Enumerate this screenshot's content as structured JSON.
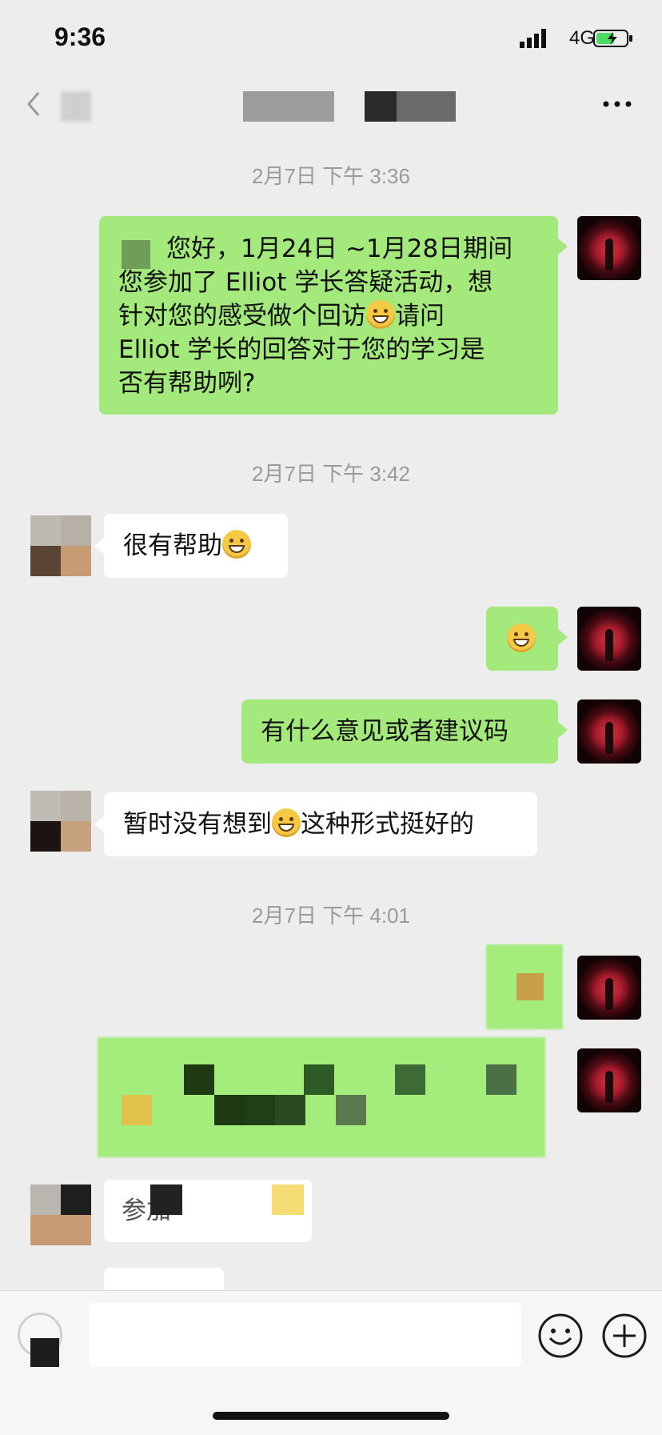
{
  "status_bar": {
    "time": "9:36",
    "network": "4G"
  },
  "nav": {
    "more_label": "•••"
  },
  "timestamps": [
    "2月7日 下午 3:36",
    "2月7日 下午 3:42",
    "2月7日 下午 4:01"
  ],
  "messages": {
    "m1_lines": [
      "您好，1月24日 ~1月28日期间",
      "您参加了 Elliot 学长答疑活动，想",
      "针对您的感受做个回访",
      "请问",
      "Elliot 学长的回答对于您的学习是",
      "否有帮助咧?"
    ],
    "m2": "很有帮助",
    "m4": "有什么意见或者建议码",
    "m5_a": "暂时没有想到",
    "m5_b": "这种形式挺好的",
    "m8": "参加"
  },
  "colors": {
    "bubble_sent": "#a4e97b",
    "bubble_received": "#ffffff",
    "background": "#ededed",
    "timestamp": "#9a9a9a"
  },
  "icons": [
    "back-chevron-icon",
    "more-icon",
    "voice-icon",
    "emoji-icon",
    "plus-icon",
    "signal-icon",
    "battery-icon"
  ]
}
